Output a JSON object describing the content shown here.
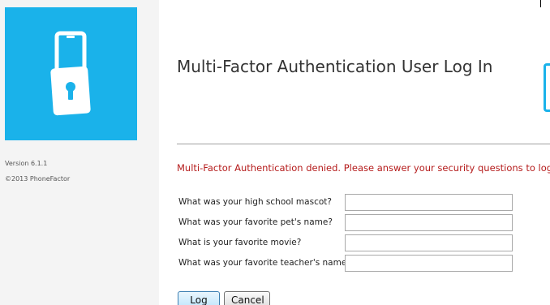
{
  "sidebar": {
    "version": "Version 6.1.1",
    "copyright": "©2013 PhoneFactor",
    "logo_icon": "phone-lock-icon",
    "brand_color": "#1ab2ea"
  },
  "main": {
    "title": "Multi-Factor Authentication User Log In",
    "error": "Multi-Factor Authentication denied. Please answer your security questions to log on.",
    "error_color": "#b51c1c",
    "questions": [
      {
        "label": "What was your high school mascot?",
        "value": ""
      },
      {
        "label": "What was your favorite pet's name?",
        "value": ""
      },
      {
        "label": "What is your favorite movie?",
        "value": ""
      },
      {
        "label": "What was your favorite teacher's name?",
        "value": ""
      }
    ],
    "buttons": {
      "login": "Log In",
      "cancel": "Cancel"
    }
  }
}
